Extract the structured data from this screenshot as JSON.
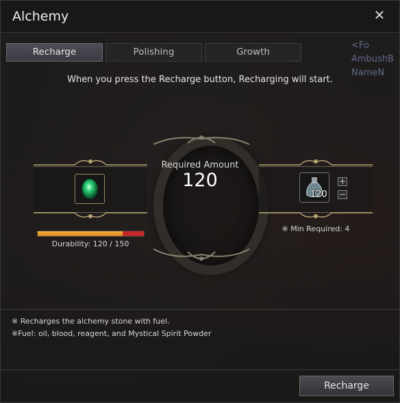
{
  "window": {
    "title": "Alchemy"
  },
  "background": {
    "names": [
      "<Fo",
      "AmbushB",
      "NameN"
    ]
  },
  "tabs": [
    {
      "label": "Recharge",
      "active": true
    },
    {
      "label": "Polishing",
      "active": false
    },
    {
      "label": "Growth",
      "active": false
    }
  ],
  "instruction": "When you press the Recharge button, Recharging will start.",
  "required": {
    "label": "Required Amount",
    "value": "120"
  },
  "stone": {
    "icon": "alchemy-stone-icon",
    "durability_text": "Durability: 120 / 150",
    "durability_current": 120,
    "durability_max": 150
  },
  "fuel": {
    "icon": "fuel-bottle-icon",
    "count": "120",
    "plus_label": "+",
    "minus_label": "−",
    "min_required": "※ Min Required: 4"
  },
  "notes": [
    "※ Recharges the alchemy stone with fuel.",
    "※Fuel: oil, blood, reagent, and Mystical Spirit Powder"
  ],
  "actions": {
    "recharge_label": "Recharge",
    "close_symbol": "✕"
  },
  "colors": {
    "durability": "#e8961f",
    "durability_lost": "#c4282a",
    "accent_gold": "#b8a472"
  }
}
